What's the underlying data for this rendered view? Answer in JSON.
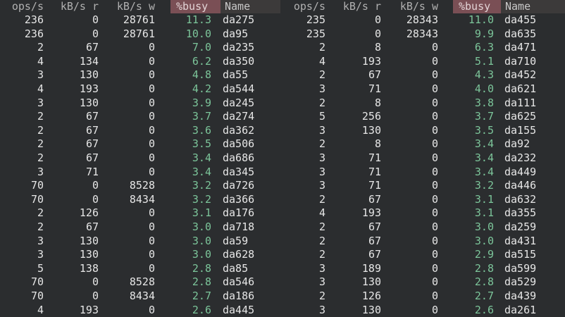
{
  "header": {
    "left": {
      "ops": "ops/s",
      "kr": "kB/s r",
      "kw": "kB/s w",
      "busy": "%busy",
      "name": "Name"
    },
    "right": {
      "ops": "ops/s",
      "kr": "kB/s r",
      "kw": "kB/s w",
      "busy": "%busy",
      "name": "Name"
    }
  },
  "rows": [
    {
      "l": [
        "236",
        "0",
        "28761",
        "11.3",
        "da275"
      ],
      "r": [
        "235",
        "0",
        "28343",
        "11.0",
        "da455"
      ]
    },
    {
      "l": [
        "236",
        "0",
        "28761",
        "10.0",
        "da95"
      ],
      "r": [
        "235",
        "0",
        "28343",
        "9.9",
        "da635"
      ]
    },
    {
      "l": [
        "2",
        "67",
        "0",
        "7.0",
        "da235"
      ],
      "r": [
        "2",
        "8",
        "0",
        "6.3",
        "da471"
      ]
    },
    {
      "l": [
        "4",
        "134",
        "0",
        "6.2",
        "da350"
      ],
      "r": [
        "4",
        "193",
        "0",
        "5.1",
        "da710"
      ]
    },
    {
      "l": [
        "3",
        "130",
        "0",
        "4.8",
        "da55"
      ],
      "r": [
        "2",
        "67",
        "0",
        "4.3",
        "da452"
      ]
    },
    {
      "l": [
        "4",
        "193",
        "0",
        "4.2",
        "da544"
      ],
      "r": [
        "3",
        "71",
        "0",
        "4.0",
        "da621"
      ]
    },
    {
      "l": [
        "3",
        "130",
        "0",
        "3.9",
        "da245"
      ],
      "r": [
        "2",
        "8",
        "0",
        "3.8",
        "da111"
      ]
    },
    {
      "l": [
        "2",
        "67",
        "0",
        "3.7",
        "da274"
      ],
      "r": [
        "5",
        "256",
        "0",
        "3.7",
        "da625"
      ]
    },
    {
      "l": [
        "2",
        "67",
        "0",
        "3.6",
        "da362"
      ],
      "r": [
        "3",
        "130",
        "0",
        "3.5",
        "da155"
      ]
    },
    {
      "l": [
        "2",
        "67",
        "0",
        "3.5",
        "da506"
      ],
      "r": [
        "2",
        "8",
        "0",
        "3.4",
        "da92"
      ]
    },
    {
      "l": [
        "2",
        "67",
        "0",
        "3.4",
        "da686"
      ],
      "r": [
        "3",
        "71",
        "0",
        "3.4",
        "da232"
      ]
    },
    {
      "l": [
        "3",
        "71",
        "0",
        "3.4",
        "da345"
      ],
      "r": [
        "3",
        "71",
        "0",
        "3.4",
        "da449"
      ]
    },
    {
      "l": [
        "70",
        "0",
        "8528",
        "3.2",
        "da726"
      ],
      "r": [
        "3",
        "71",
        "0",
        "3.2",
        "da446"
      ]
    },
    {
      "l": [
        "70",
        "0",
        "8434",
        "3.2",
        "da366"
      ],
      "r": [
        "2",
        "67",
        "0",
        "3.1",
        "da632"
      ]
    },
    {
      "l": [
        "2",
        "126",
        "0",
        "3.1",
        "da176"
      ],
      "r": [
        "4",
        "193",
        "0",
        "3.1",
        "da355"
      ]
    },
    {
      "l": [
        "2",
        "67",
        "0",
        "3.0",
        "da718"
      ],
      "r": [
        "2",
        "67",
        "0",
        "3.0",
        "da259"
      ]
    },
    {
      "l": [
        "3",
        "130",
        "0",
        "3.0",
        "da59"
      ],
      "r": [
        "2",
        "67",
        "0",
        "3.0",
        "da431"
      ]
    },
    {
      "l": [
        "3",
        "130",
        "0",
        "3.0",
        "da628"
      ],
      "r": [
        "2",
        "67",
        "0",
        "2.9",
        "da515"
      ]
    },
    {
      "l": [
        "5",
        "138",
        "0",
        "2.8",
        "da85"
      ],
      "r": [
        "3",
        "189",
        "0",
        "2.8",
        "da599"
      ]
    },
    {
      "l": [
        "70",
        "0",
        "8528",
        "2.8",
        "da546"
      ],
      "r": [
        "3",
        "130",
        "0",
        "2.8",
        "da529"
      ]
    },
    {
      "l": [
        "70",
        "0",
        "8434",
        "2.7",
        "da186"
      ],
      "r": [
        "2",
        "126",
        "0",
        "2.7",
        "da439"
      ]
    },
    {
      "l": [
        "4",
        "193",
        "0",
        "2.6",
        "da445"
      ],
      "r": [
        "3",
        "130",
        "0",
        "2.6",
        "da261"
      ]
    }
  ],
  "colors": {
    "background": "#2b2d2f",
    "text": "#e6e6e6",
    "busy_value": "#7cc59a",
    "busy_header_bg": "#7a4f55",
    "name_header_bg": "#3c3a3a"
  }
}
